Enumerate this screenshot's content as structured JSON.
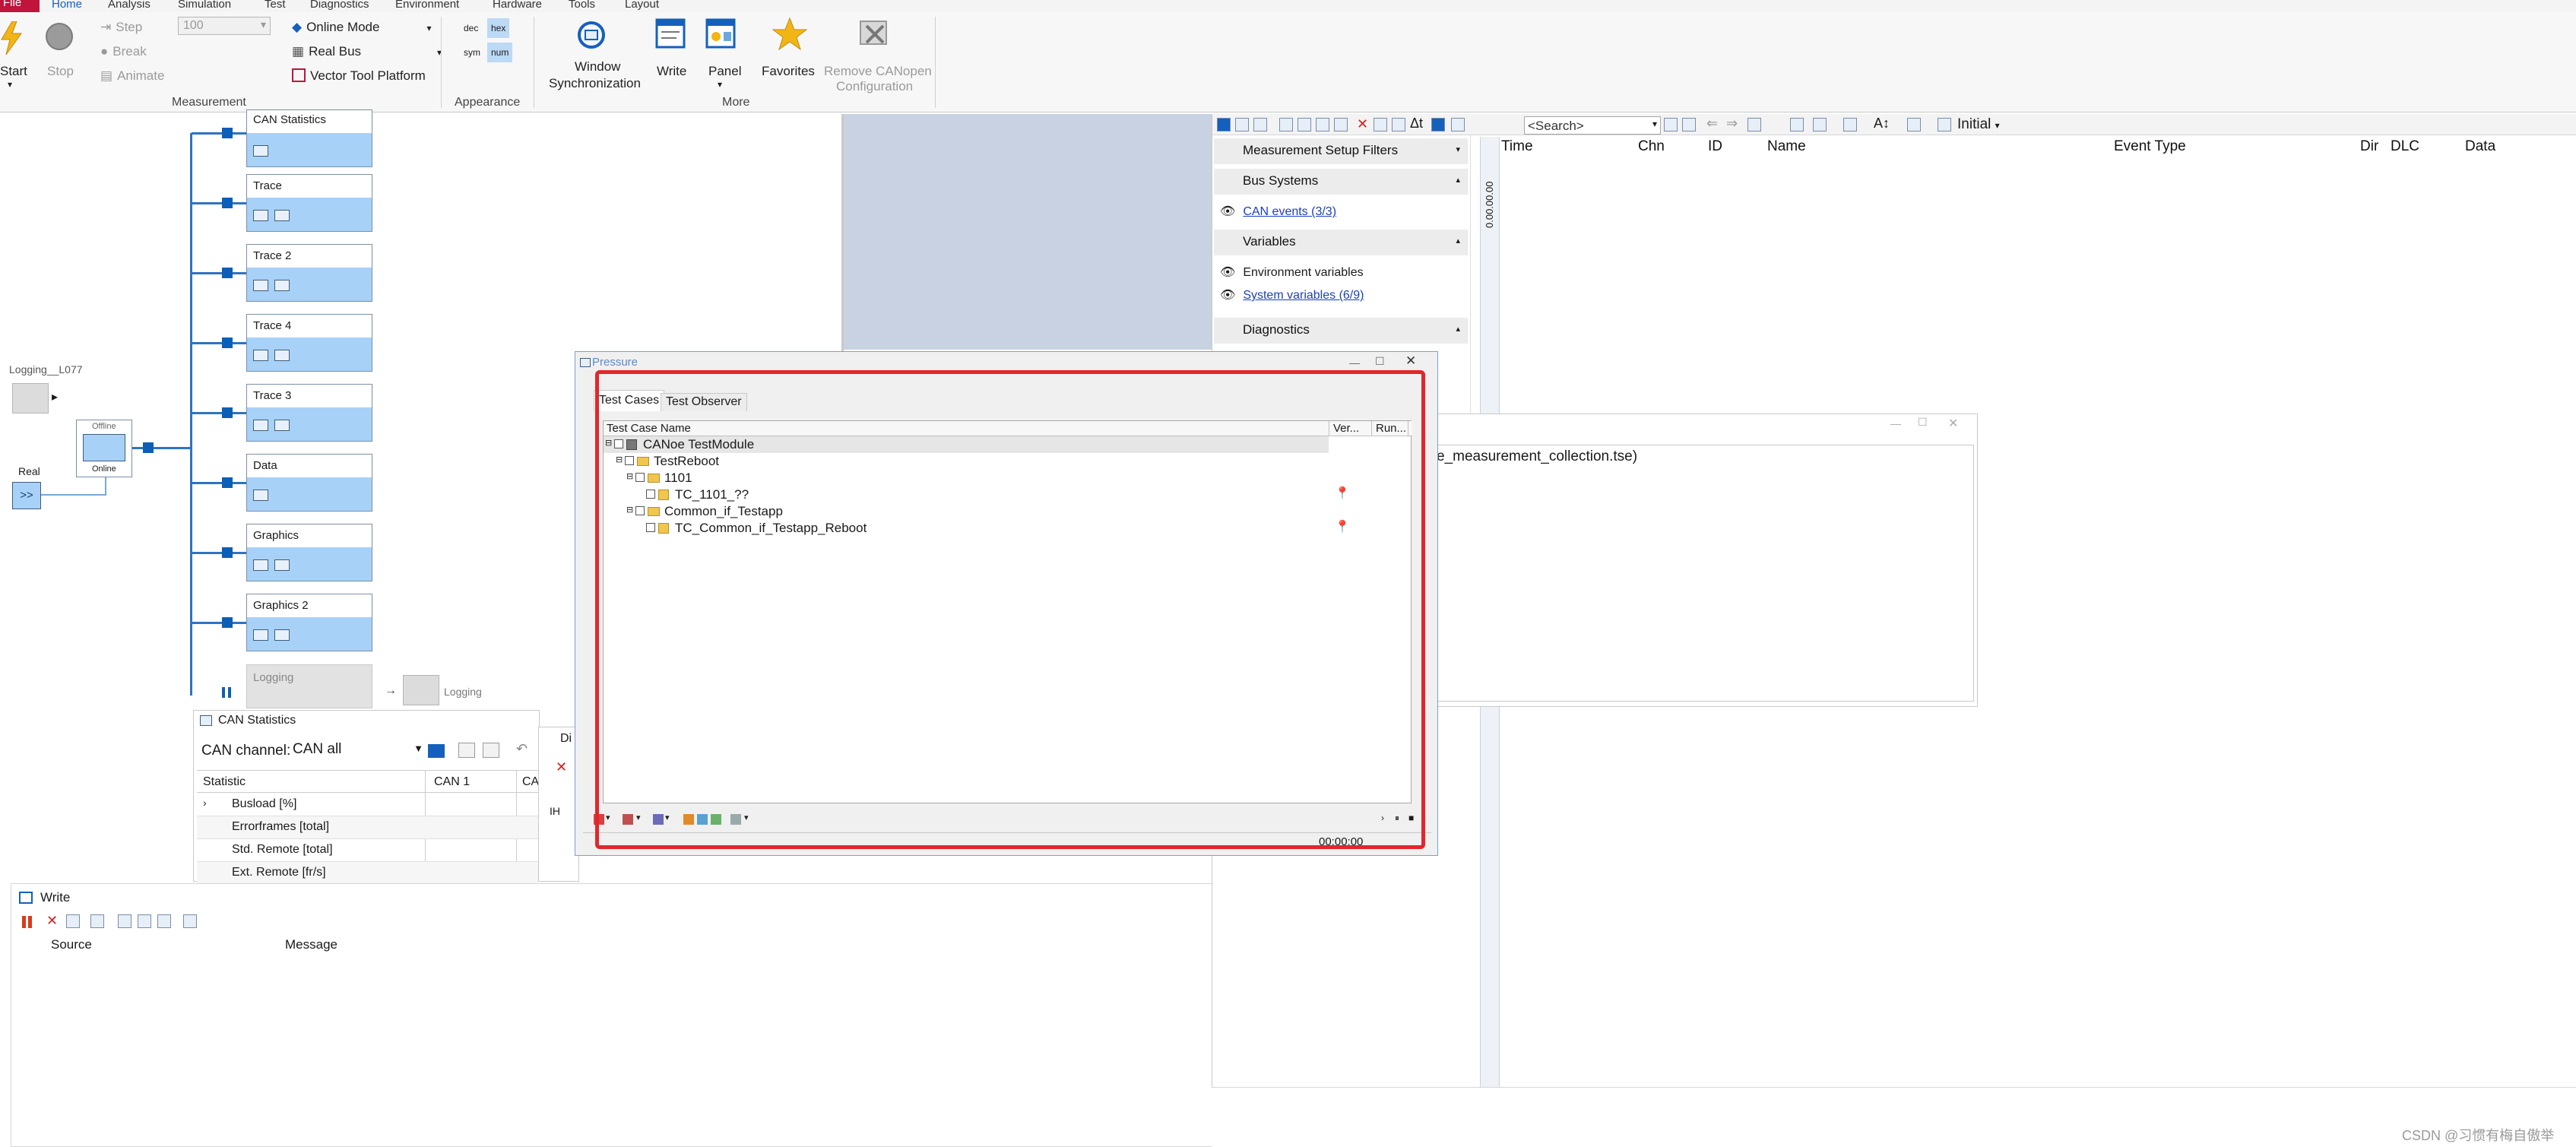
{
  "ribbon": {
    "tabs": [
      "File",
      "Home",
      "Analysis",
      "Simulation",
      "Test",
      "Diagnostics",
      "Environment",
      "Hardware",
      "Tools",
      "Layout"
    ],
    "measurement": {
      "start": "Start",
      "stop": "Stop",
      "step": "Step",
      "break": "Break",
      "animate": "Animate",
      "speed_value": "100",
      "online_mode": "Online Mode",
      "real_bus": "Real Bus",
      "vector_tool_platform": "Vector Tool Platform",
      "group_label": "Measurement"
    },
    "appearance": {
      "dec": "dec",
      "hex": "hex",
      "sym": "sym",
      "num": "num",
      "group_label": "Appearance"
    },
    "more": {
      "window_sync_1": "Window",
      "window_sync_2": "Synchronization",
      "write": "Write",
      "panel": "Panel",
      "favorites": "Favorites",
      "remove_canopen_1": "Remove CANopen",
      "remove_canopen_2": "Configuration",
      "group_label": "More"
    },
    "colors": {
      "file_tab": "#c0143c",
      "accent": "#1560bd"
    }
  },
  "setup": {
    "nodes": [
      "CAN Statistics",
      "Trace",
      "Trace 2",
      "Trace 4",
      "Trace 3",
      "Data",
      "Graphics",
      "Graphics 2",
      "Logging"
    ],
    "logging_label": "Logging",
    "logging_source": "Logging__L077",
    "offline": "Offline",
    "online": "Online",
    "real": "Real",
    "real_btn": ">>"
  },
  "can_statistics": {
    "title": "CAN Statistics",
    "channel_label": "CAN channel:",
    "channel_value": "CAN all",
    "columns": [
      "Statistic",
      "CAN 1",
      "CAN"
    ],
    "rows": [
      "Busload [%]",
      "Errorframes [total]",
      "Std. Remote [total]",
      "Ext. Remote [fr/s]"
    ]
  },
  "diag_fragment": {
    "title": "Di",
    "row": "IH"
  },
  "write_window": {
    "title": "Write",
    "columns": [
      "Source",
      "Message"
    ]
  },
  "trace": {
    "search_placeholder": "<Search>",
    "initial": "Initial",
    "filters": {
      "measurement_setup_filters": "Measurement Setup Filters",
      "bus_systems": "Bus Systems",
      "can_events": "CAN events (3/3)",
      "variables": "Variables",
      "environment_variables": "Environment variables",
      "system_variables": "System variables (6/9)",
      "diagnostics": "Diagnostics"
    },
    "time_ruler": "0.00.00.00",
    "columns": [
      "Time",
      "Chn",
      "ID",
      "Name",
      "Event Type",
      "Dir",
      "DLC",
      "Data"
    ]
  },
  "test_output": {
    "text": "e_measurement_collection.tse)"
  },
  "pressure": {
    "title": "Pressure",
    "tabs": [
      "Test Cases",
      "Test Observer"
    ],
    "columns": [
      "Test Case Name",
      "Ver...",
      "Run..."
    ],
    "tree": [
      "CANoe TestModule",
      "TestReboot",
      "1101",
      "TC_1101_??",
      "Common_if_Testapp",
      "TC_Common_if_Testapp_Reboot"
    ],
    "status_time": "00:00:00",
    "highlight_color": "#e3262b"
  },
  "watermark": "CSDN @习惯有梅自傲举"
}
